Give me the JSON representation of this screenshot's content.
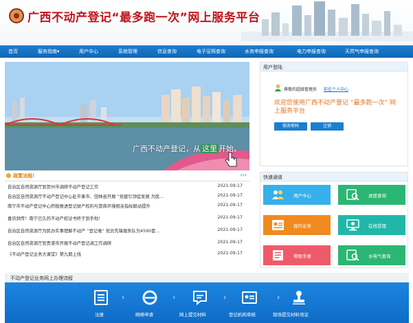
{
  "header": {
    "site_title": "广西不动产登记“最多跑一次”网上服务平台"
  },
  "nav": {
    "items": [
      "首页",
      "服务指南▾",
      "用户中心",
      "系统管理",
      "信息查询",
      "电子证照查询",
      "水务申报查询",
      "电力申报查询",
      "天然气申报查询"
    ]
  },
  "banner": {
    "caption_prefix": "广西不动产登记，从",
    "caption_highlight": "这里",
    "caption_suffix": "开始。"
  },
  "news": {
    "title": "政策法规！",
    "more": "›››",
    "items": [
      {
        "title": "自治区自然资源厅到贺州市调研不动产登记工作",
        "date": "2021-09-17"
      },
      {
        "title": "自治区自然资源厅不动产登记中心赴平果市、田林县开展 “党建引领促发展 为民...",
        "date": "2021-09-17"
      },
      {
        "title": "南宁市不动产登记中心积极推进登记财产权利与营商环境相关指标联动提升",
        "date": "2021-09-17"
      },
      {
        "title": "喜讯频传！南宁已久的不动产权证书终于到手啦！",
        "date": "2021-09-17"
      },
      {
        "title": "自治区自然资源厅为民办实事理解不动产 “登记难” 党员先锋服务队为4590套...",
        "date": "2021-09-17"
      },
      {
        "title": "自治区自然资源厅到贵港市开展不动产登记调工作调研",
        "date": "2021-09-17"
      },
      {
        "title": "《不动产登记业务大课堂》第九期上线",
        "date": "2021-09-17"
      }
    ]
  },
  "login": {
    "head": "用户登陆",
    "user_name": "尊敬的超级管理员",
    "user_link": "前往个人中心",
    "welcome": "欢迎您使用广西不动产登记 “最多跑一次” 网上服务平台",
    "btn_password": "修改密码",
    "btn_logout": "注销"
  },
  "quick": {
    "head": "快速通道",
    "tiles": [
      {
        "label": "用户中心",
        "color": "#36b0ea",
        "icon": "users-icon"
      },
      {
        "label": "进度查询",
        "color": "#2bb673",
        "icon": "search-progress-icon"
      },
      {
        "label": "我的业务",
        "color": "#f08a1f",
        "icon": "business-icon"
      },
      {
        "label": "在线受理",
        "color": "#21b7a8",
        "icon": "online-accept-icon"
      },
      {
        "label": "帮助手册",
        "color": "#ef5a6a",
        "icon": "help-book-icon"
      },
      {
        "label": "水电气查询",
        "color": "#2bb673",
        "icon": "utility-query-icon"
      }
    ]
  },
  "process": {
    "head": "不动产登记业务网上办理流程",
    "steps": [
      {
        "label": "注册",
        "icon": "register-icon"
      },
      {
        "label": "网络申请",
        "icon": "browser-icon"
      },
      {
        "label": "网上提交材料",
        "icon": "submit-material-icon"
      },
      {
        "label": "登记机构审核",
        "icon": "review-icon"
      },
      {
        "label": "现场提交材料领证",
        "icon": "stamp-icon"
      }
    ]
  },
  "colors": {
    "nav_blue": "#1572c5",
    "title_red": "#c0141b",
    "welcome_orange": "#e4731c",
    "process_blue": "#1580d9"
  }
}
